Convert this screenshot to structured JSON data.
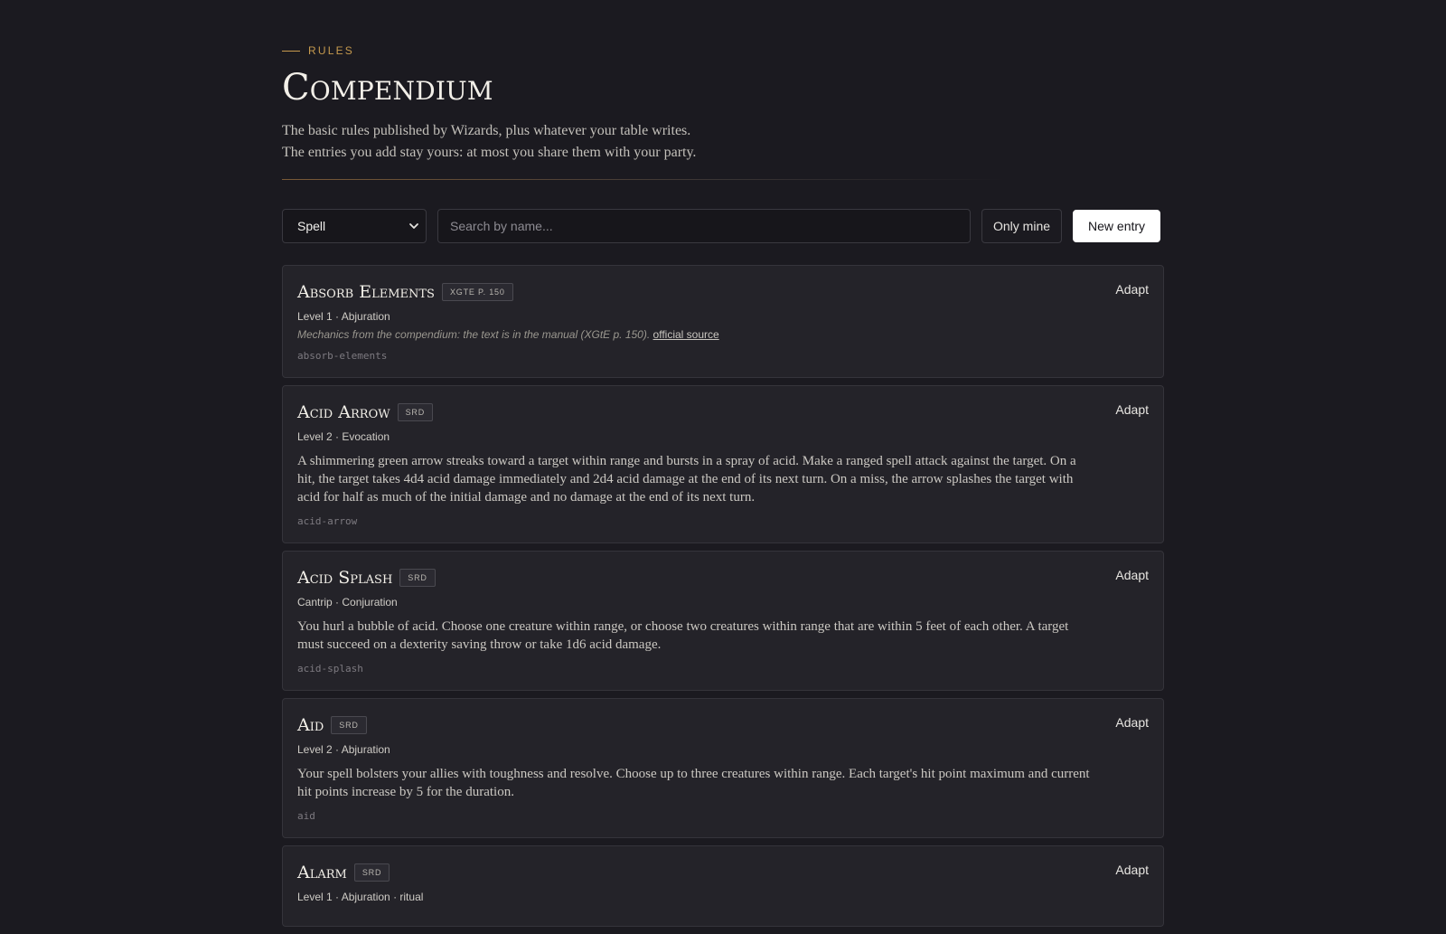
{
  "header": {
    "eyebrow": "RULES",
    "title": "Compendium",
    "intro_line1": "The basic rules published by Wizards, plus whatever your table writes.",
    "intro_line2": "The entries you add stay yours: at most you share them with your party."
  },
  "toolbar": {
    "type_select": {
      "selected": "Spell"
    },
    "search_placeholder": "Search by name...",
    "only_mine_label": "Only mine",
    "new_entry_label": "New entry"
  },
  "entries": [
    {
      "name": "Absorb Elements",
      "badge": "XGTE P. 150",
      "meta": "Level 1 · Abjuration",
      "note": "Mechanics from the compendium: the text is in the manual (XGtE p. 150).",
      "note_link": "official source",
      "description": "",
      "slug": "absorb-elements",
      "action": "Adapt"
    },
    {
      "name": "Acid Arrow",
      "badge": "SRD",
      "meta": "Level 2 · Evocation",
      "description": "A shimmering green arrow streaks toward a target within range and bursts in a spray of acid. Make a ranged spell attack against the target. On a hit, the target takes 4d4 acid damage immediately and 2d4 acid damage at the end of its next turn. On a miss, the arrow splashes the target with acid for half as much of the initial damage and no damage at the end of its next turn.",
      "slug": "acid-arrow",
      "action": "Adapt"
    },
    {
      "name": "Acid Splash",
      "badge": "SRD",
      "meta": "Cantrip · Conjuration",
      "description": "You hurl a bubble of acid. Choose one creature within range, or choose two creatures within range that are within 5 feet of each other. A target must succeed on a dexterity saving throw or take 1d6 acid damage.",
      "slug": "acid-splash",
      "action": "Adapt"
    },
    {
      "name": "Aid",
      "badge": "SRD",
      "meta": "Level 2 · Abjuration",
      "description": "Your spell bolsters your allies with toughness and resolve. Choose up to three creatures within range. Each target's hit point maximum and current hit points increase by 5 for the duration.",
      "slug": "aid",
      "action": "Adapt"
    },
    {
      "name": "Alarm",
      "badge": "SRD",
      "meta": "Level 1 · Abjuration · ritual",
      "description": "",
      "slug": "",
      "action": "Adapt"
    }
  ]
}
